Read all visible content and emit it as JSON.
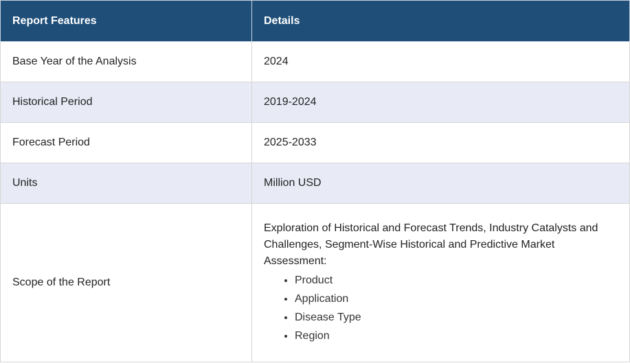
{
  "table": {
    "headers": [
      "Report Features",
      "Details"
    ],
    "rows": [
      {
        "feature": "Base Year of the Analysis",
        "detail": "2024"
      },
      {
        "feature": "Historical Period",
        "detail": "2019-2024"
      },
      {
        "feature": "Forecast Period",
        "detail": "2025-2033"
      },
      {
        "feature": "Units",
        "detail": "Million USD"
      }
    ],
    "scope": {
      "feature": "Scope of the Report",
      "text": "Exploration of Historical and Forecast Trends, Industry Catalysts and Challenges, Segment-Wise Historical and Predictive Market Assessment:",
      "items": [
        "Product",
        "Application",
        "Disease Type",
        "Region"
      ]
    }
  },
  "colors": {
    "header_bg": "#1f4e79",
    "header_text": "#ffffff",
    "alt_row_bg": "#e8eaf6",
    "border": "#d6d6d6"
  }
}
